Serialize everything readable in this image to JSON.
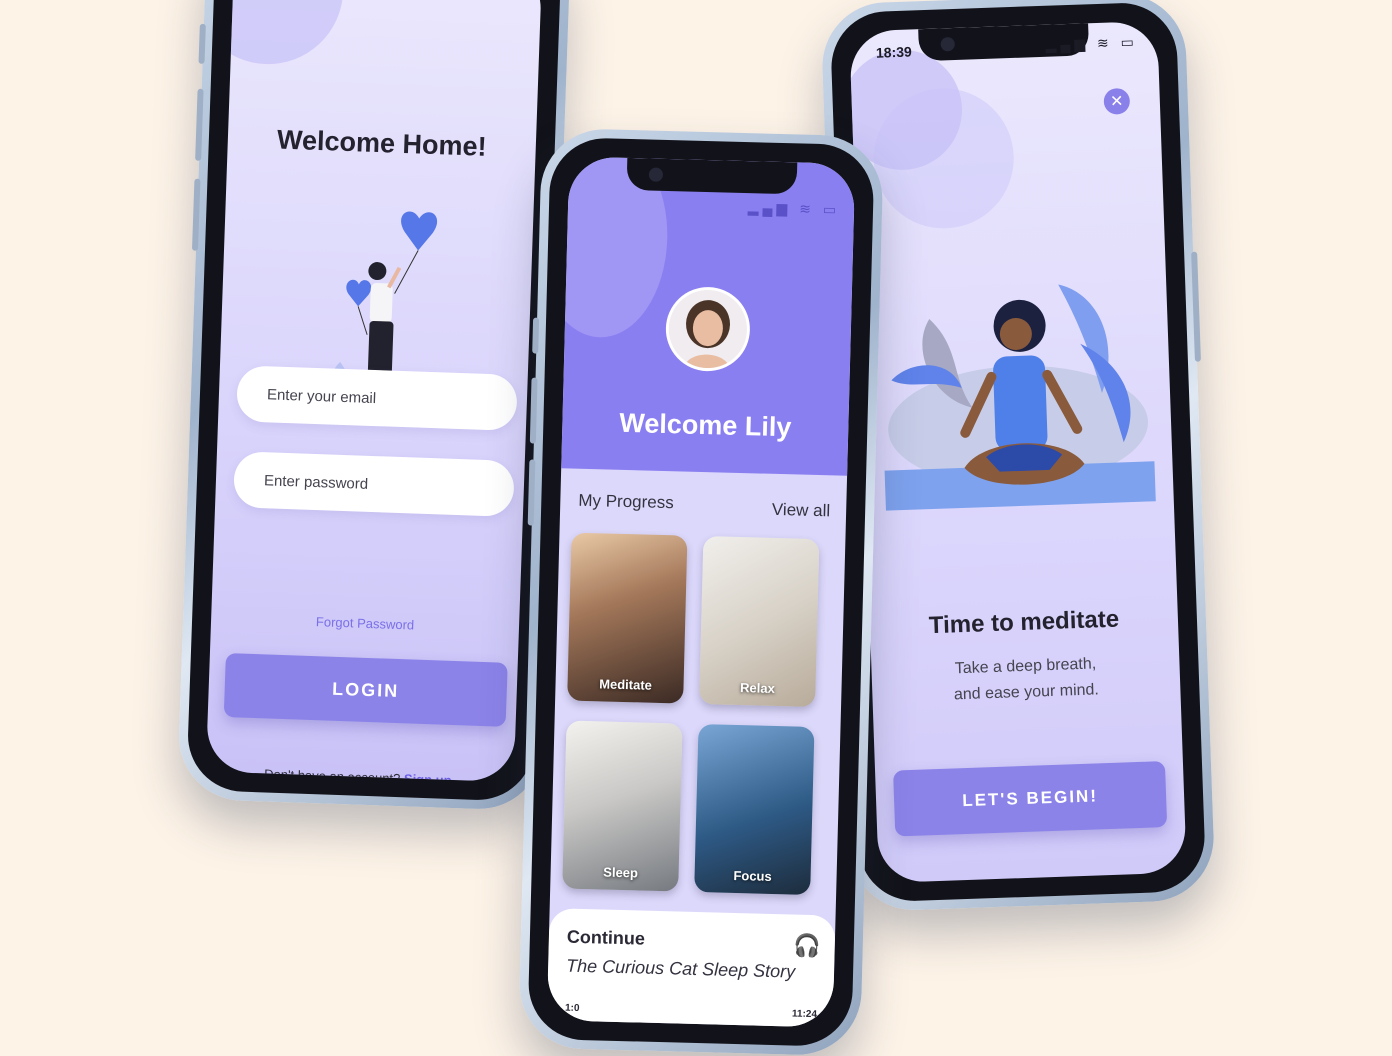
{
  "login_screen": {
    "title": "Welcome Home!",
    "email_placeholder": "Enter your email",
    "password_placeholder": "Enter password",
    "forgot_password": "Forgot Password",
    "login_button": "LOGIN",
    "signup_prompt": "Don't have an account?",
    "signup_link": "Sign up."
  },
  "home_screen": {
    "welcome": "Welcome Lily",
    "progress_label": "My Progress",
    "view_all": "View all",
    "tiles": [
      {
        "label": "Meditate"
      },
      {
        "label": "Relax"
      },
      {
        "label": "Sleep"
      },
      {
        "label": "Focus"
      }
    ],
    "continue": {
      "title": "Continue",
      "story": "The Curious Cat Sleep Story",
      "time_start": "1:0",
      "time_end": "11:24",
      "icon": "headphones-icon"
    }
  },
  "meditate_screen": {
    "status_time": "18:39",
    "title": "Time to meditate",
    "subtitle_line1": "Take a deep breath,",
    "subtitle_line2": "and ease your mind.",
    "begin_button": "LET'S BEGIN!"
  },
  "colors": {
    "background": "#fdf3e7",
    "accent": "#8c83e9",
    "header": "#8a7ff1",
    "link": "#6a5de6"
  }
}
